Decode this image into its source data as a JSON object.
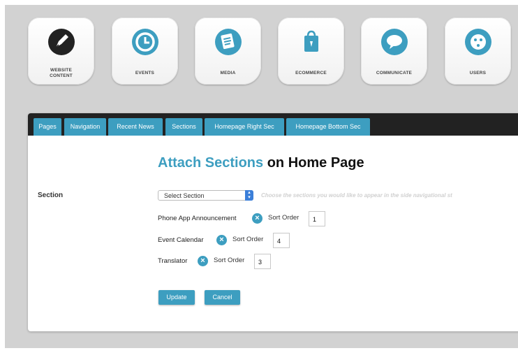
{
  "tiles": [
    {
      "label": "WEBSITE\nCONTENT",
      "icon": "website-content-icon"
    },
    {
      "label": "EVENTS",
      "icon": "clock-icon"
    },
    {
      "label": "MEDIA",
      "icon": "media-icon"
    },
    {
      "label": "ECOMMERCE",
      "icon": "shopping-bag-icon"
    },
    {
      "label": "COMMUNICATE",
      "icon": "speech-bubble-icon"
    },
    {
      "label": "USERS",
      "icon": "users-icon"
    }
  ],
  "tabs": [
    "Pages",
    "Navigation",
    "Recent News",
    "Sections",
    "Homepage Right Sec",
    "Homepage Bottom Sec"
  ],
  "heading": {
    "accent": "Attach Sections",
    "rest": " on Home Page"
  },
  "form": {
    "section_label": "Section",
    "select_value": "Select Section",
    "hint": "Choose the sections you would like to appear in the side navigational st",
    "sort_label": "Sort Order",
    "rows": [
      {
        "name": "Phone App Announcement",
        "sort": "1"
      },
      {
        "name": "Event Calendar",
        "sort": "4"
      },
      {
        "name": "Translator",
        "sort": "3"
      }
    ],
    "update_label": "Update",
    "cancel_label": "Cancel"
  },
  "colors": {
    "accent": "#3d9ec0",
    "tabbar": "#222222",
    "background": "#d2d2d2"
  }
}
